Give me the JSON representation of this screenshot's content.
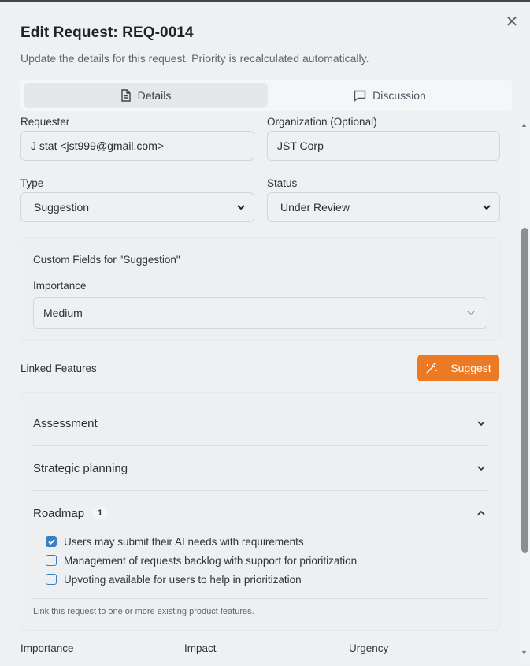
{
  "dialog": {
    "title": "Edit Request: REQ-0014",
    "description": "Update the details for this request. Priority is recalculated automatically.",
    "close_icon": "close-icon"
  },
  "tabs": [
    {
      "label": "Details",
      "icon": "document-icon",
      "active": true
    },
    {
      "label": "Discussion",
      "icon": "chat-bubble-icon",
      "active": false
    }
  ],
  "form": {
    "requester": {
      "label": "Requester",
      "value": "J stat <jst999@gmail.com>"
    },
    "organization": {
      "label": "Organization (Optional)",
      "value": "JST Corp"
    },
    "type": {
      "label": "Type",
      "value": "Suggestion"
    },
    "status": {
      "label": "Status",
      "value": "Under Review"
    }
  },
  "custom_fields": {
    "title": "Custom Fields for \"Suggestion\"",
    "importance": {
      "label": "Importance",
      "value": "Medium"
    }
  },
  "linked_features": {
    "label": "Linked Features",
    "suggest_label": "Suggest",
    "suggest_icon": "magic-wand-icon",
    "color_suggest": "#ec7a24",
    "sections": [
      {
        "title": "Assessment",
        "expanded": false
      },
      {
        "title": "Strategic planning",
        "expanded": false
      },
      {
        "title": "Roadmap",
        "badge": "1",
        "expanded": true
      }
    ],
    "roadmap_items": [
      {
        "label": "Users may submit their AI needs with requirements",
        "checked": true
      },
      {
        "label": "Management of requests backlog with support for prioritization",
        "checked": false
      },
      {
        "label": "Upvoting available for users to help in prioritization",
        "checked": false
      }
    ],
    "hint": "Link this request to one or more existing product features."
  },
  "priority_columns": [
    "Importance",
    "Impact",
    "Urgency"
  ],
  "colors": {
    "accent": "#3a7fc4",
    "background": "#eef0f1"
  }
}
